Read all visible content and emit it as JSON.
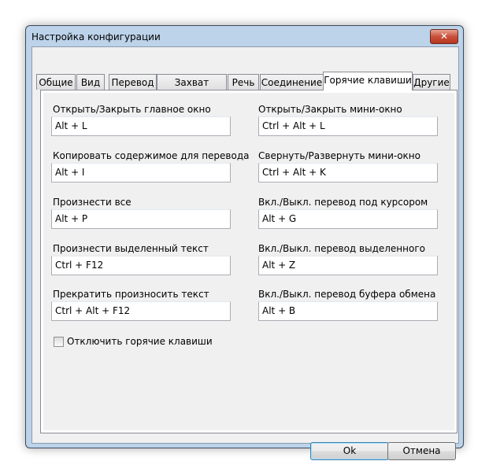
{
  "window": {
    "title": "Настройка конфигурации",
    "close_icon": "close-icon"
  },
  "tabs": [
    {
      "label": "Общие",
      "active": false
    },
    {
      "label": "Вид",
      "active": false
    },
    {
      "label": "Перевод",
      "active": false
    },
    {
      "label": "Захват текста",
      "active": false
    },
    {
      "label": "Речь",
      "active": false
    },
    {
      "label": "Соединение",
      "active": false
    },
    {
      "label": "Горячие клавиши",
      "active": true
    },
    {
      "label": "Другие",
      "active": false
    }
  ],
  "hotkeys": [
    {
      "label": "Открыть/Закрыть главное окно",
      "value": "Alt + L"
    },
    {
      "label": "Открыть/Закрыть мини-окно",
      "value": "Ctrl + Alt + L"
    },
    {
      "label": "Копировать содержимое для перевода",
      "value": "Alt + I"
    },
    {
      "label": "Свернуть/Развернуть мини-окно",
      "value": "Ctrl + Alt + K"
    },
    {
      "label": "Произнести все",
      "value": "Alt + P"
    },
    {
      "label": "Вкл./Выкл. перевод под курсором",
      "value": "Alt + G"
    },
    {
      "label": "Произнести выделенный текст",
      "value": "Ctrl + F12"
    },
    {
      "label": "Вкл./Выкл. перевод выделенного текста",
      "value": "Alt + Z"
    },
    {
      "label": "Прекратить произносить текст",
      "value": "Ctrl + Alt + F12"
    },
    {
      "label": "Вкл./Выкл. перевод буфера обмена",
      "value": "Alt + B"
    }
  ],
  "disable_hotkeys": {
    "label": "Отключить горячие клавиши",
    "checked": false
  },
  "buttons": {
    "ok": "Ok",
    "cancel": "Отмена"
  }
}
